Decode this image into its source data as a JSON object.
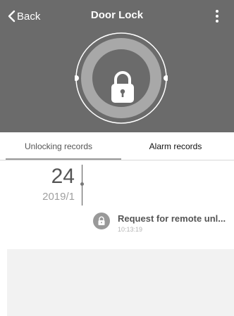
{
  "header": {
    "back_label": "Back",
    "title": "Door Lock",
    "more_icon": "more-vertical-icon",
    "lock_icon": "padlock-icon"
  },
  "tabs": [
    {
      "label": "Unlocking records",
      "active": true
    },
    {
      "label": "Alarm records",
      "active": false
    }
  ],
  "records": {
    "date_day": "24",
    "date_month": "2019/1",
    "items": [
      {
        "title": "Request for remote unl...",
        "time": "10:13:19",
        "icon": "padlock-icon"
      }
    ]
  },
  "colors": {
    "header_bg": "#6b6b6b",
    "ring": "#ffffff",
    "bottom_bg": "#f2f2f2"
  }
}
